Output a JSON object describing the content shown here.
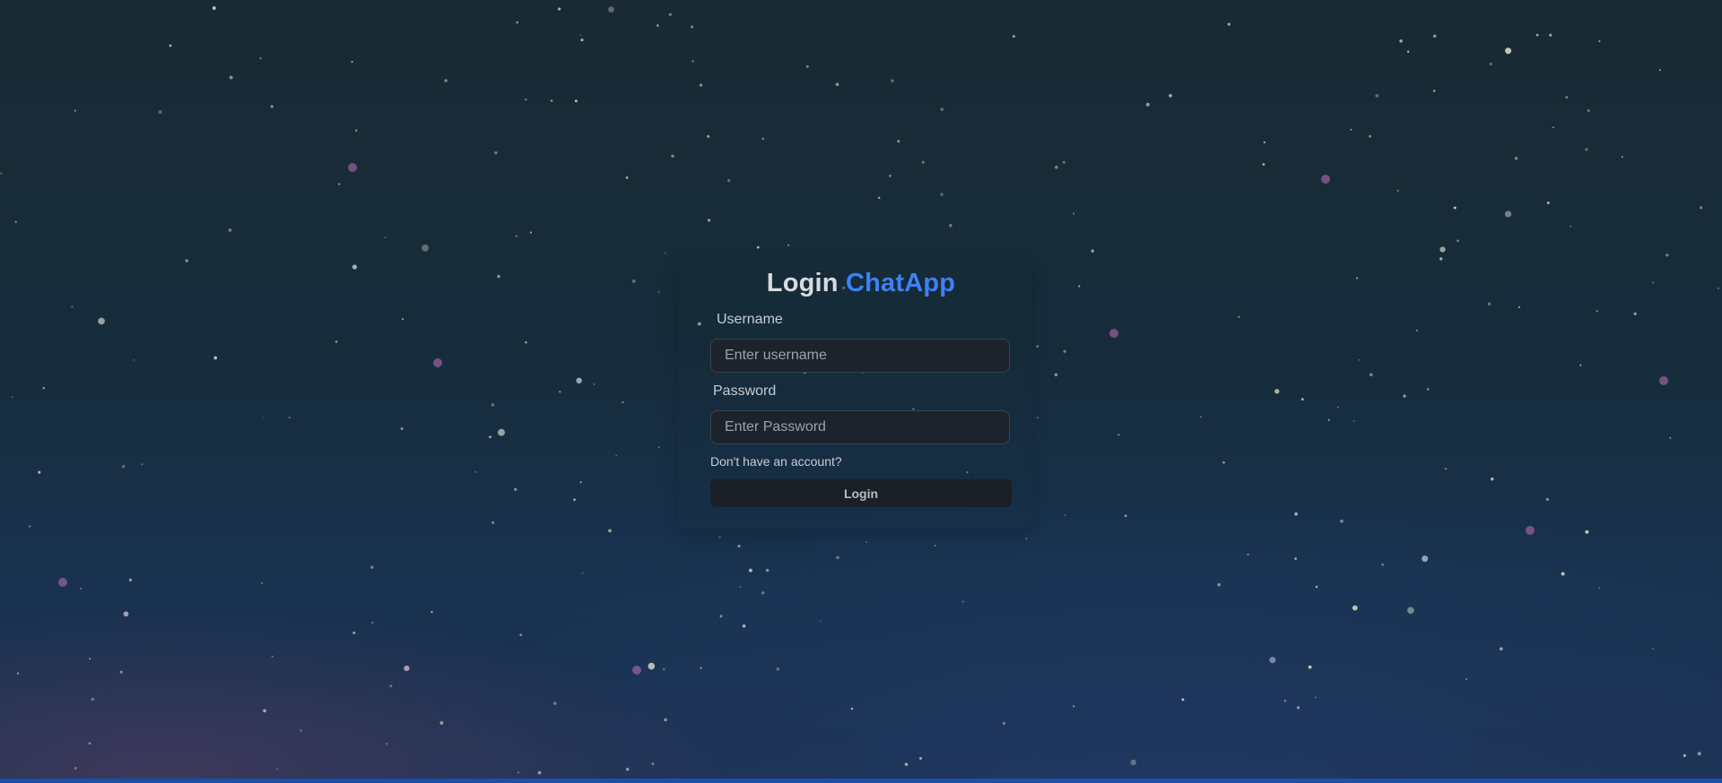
{
  "login": {
    "title_prefix": "Login",
    "title_brand": "ChatApp",
    "username": {
      "label": "Username",
      "placeholder": "Enter username",
      "value": ""
    },
    "password": {
      "label": "Password",
      "placeholder": "Enter Password",
      "value": ""
    },
    "signup_link": "Don't have an account?",
    "submit_label": "Login"
  },
  "colors": {
    "brand_accent": "#3b82f6",
    "input_background": "#1d232b",
    "button_background": "#1b1f26",
    "bottom_bar": "#1b4fa8"
  },
  "background": {
    "description_icon": "starry-night-sky"
  }
}
